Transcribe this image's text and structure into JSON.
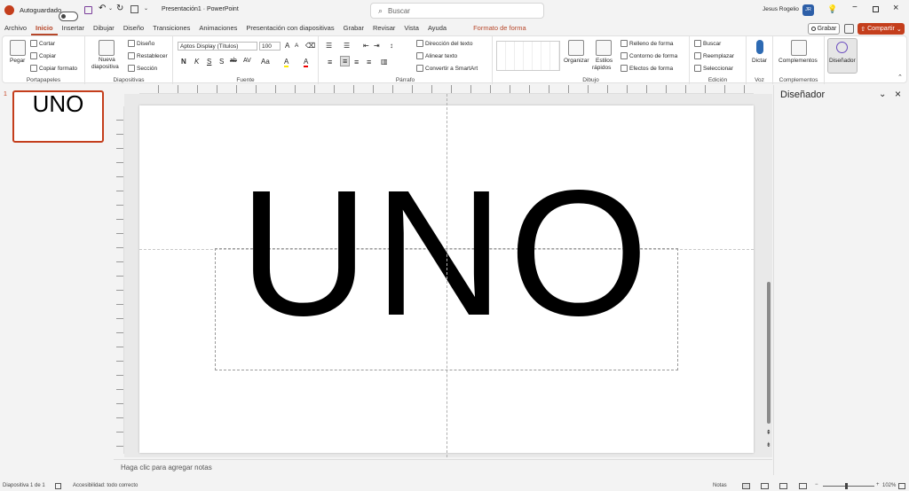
{
  "titlebar": {
    "autosave_label": "Autoguardado",
    "doc_title": "Presentación1  ·  PowerPoint",
    "search_placeholder": "Buscar",
    "user_name": "Jesus Rogelio",
    "user_initials": "JR"
  },
  "tabs": [
    {
      "label": "Archivo"
    },
    {
      "label": "Inicio",
      "active": true
    },
    {
      "label": "Insertar"
    },
    {
      "label": "Dibujar"
    },
    {
      "label": "Diseño"
    },
    {
      "label": "Transiciones"
    },
    {
      "label": "Animaciones"
    },
    {
      "label": "Presentación con diapositivas"
    },
    {
      "label": "Grabar"
    },
    {
      "label": "Revisar"
    },
    {
      "label": "Vista"
    },
    {
      "label": "Ayuda"
    },
    {
      "label": "Formato de forma",
      "contextual": true
    }
  ],
  "actions": {
    "grabar": "Grabar",
    "compartir": "Compartir"
  },
  "ribbon": {
    "portapapeles": {
      "label": "Portapapeles",
      "pegar": "Pegar",
      "cortar": "Cortar",
      "copiar": "Copiar",
      "copiar_formato": "Copiar formato"
    },
    "diapositivas": {
      "label": "Diapositivas",
      "nueva": "Nueva",
      "diapositiva": "diapositiva",
      "diseno": "Diseño",
      "restablecer": "Restablecer",
      "seccion": "Sección"
    },
    "fuente": {
      "label": "Fuente",
      "font_name": "Aptos Display (Títulos)",
      "font_size": "100",
      "bold": "N",
      "italic": "K",
      "underline": "S",
      "shadow": "S",
      "strike": "ab",
      "spacing": "AV",
      "case": "Aa",
      "highlight": "A",
      "color": "A",
      "grow": "A",
      "shrink": "A"
    },
    "parrafo": {
      "label": "Párrafo",
      "direccion": "Dirección del texto",
      "alinear": "Alinear texto",
      "smartart": "Convertir a SmartArt"
    },
    "dibujo": {
      "label": "Dibujo",
      "organizar": "Organizar",
      "estilos": "Estilos",
      "rapidos": "rápidos",
      "relleno": "Relleno de forma",
      "contorno": "Contorno de forma",
      "efectos": "Efectos de forma"
    },
    "edicion": {
      "label": "Edición",
      "buscar": "Buscar",
      "reemplazar": "Reemplazar",
      "seleccionar": "Seleccionar"
    },
    "voz": {
      "label": "Voz",
      "dictar": "Dictar"
    },
    "complementos": {
      "label": "Complementos",
      "complementos_btn": "Complementos"
    },
    "disenador": {
      "label": "Diseñador"
    }
  },
  "slides_pane": {
    "slide_number": "1",
    "thumb_text": "UNO"
  },
  "slide": {
    "text": "UNO"
  },
  "notes_placeholder": "Haga clic para agregar notas",
  "designer_pane": {
    "title": "Diseñador"
  },
  "statusbar": {
    "slide_count": "Diapositiva 1 de 1",
    "accessibility": "Accesibilidad: todo correcto",
    "notes": "Notas",
    "zoom": "102%"
  },
  "colors": {
    "accent": "#c43e1c",
    "tab_active": "#b7472a"
  }
}
